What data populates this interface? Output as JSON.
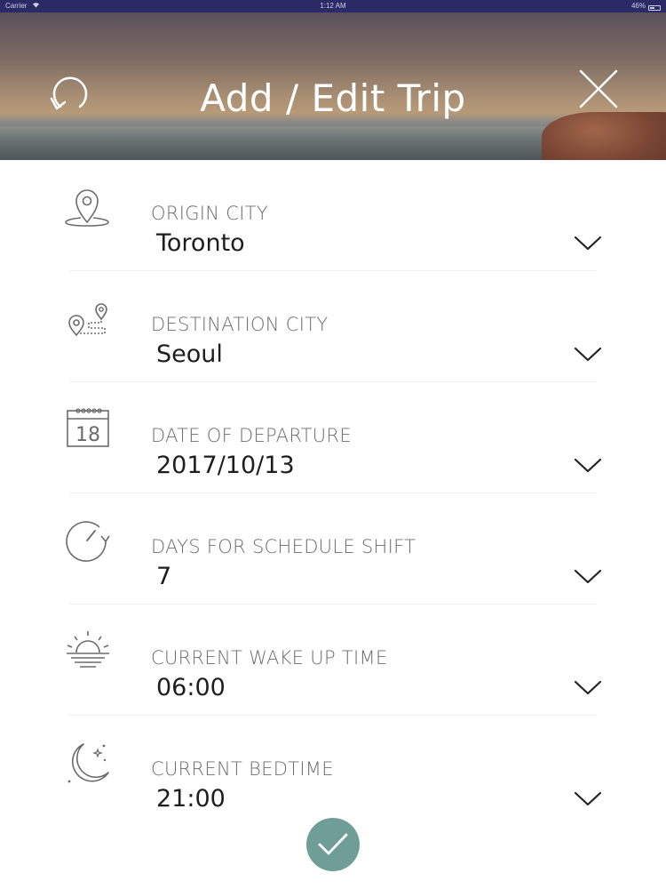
{
  "status_bar": {
    "carrier": "Carrier",
    "time": "1:12 AM",
    "battery": "46%"
  },
  "header": {
    "title": "Add / Edit Trip",
    "left_icon": "refresh-icon",
    "right_icon": "close-icon"
  },
  "fields": [
    {
      "label": "ORIGIN CITY",
      "value": "Toronto",
      "icon": "location-pin-icon"
    },
    {
      "label": "DESTINATION CITY",
      "value": "Seoul",
      "icon": "route-icon"
    },
    {
      "label": "DATE OF DEPARTURE",
      "value": "2017/10/13",
      "icon": "calendar-icon",
      "icon_text": "18"
    },
    {
      "label": "DAYS FOR SCHEDULE SHIFT",
      "value": "7",
      "icon": "clock-shift-icon"
    },
    {
      "label": "CURRENT WAKE UP TIME",
      "value": "06:00",
      "icon": "sunrise-icon"
    },
    {
      "label": "CURRENT BEDTIME",
      "value": "21:00",
      "icon": "moon-icon"
    }
  ],
  "colors": {
    "accent": "#6f9e96",
    "label": "#6d6d6d",
    "icon": "#6b6b6b",
    "status_bar": "#2a2b66"
  },
  "confirm_icon": "checkmark-icon"
}
